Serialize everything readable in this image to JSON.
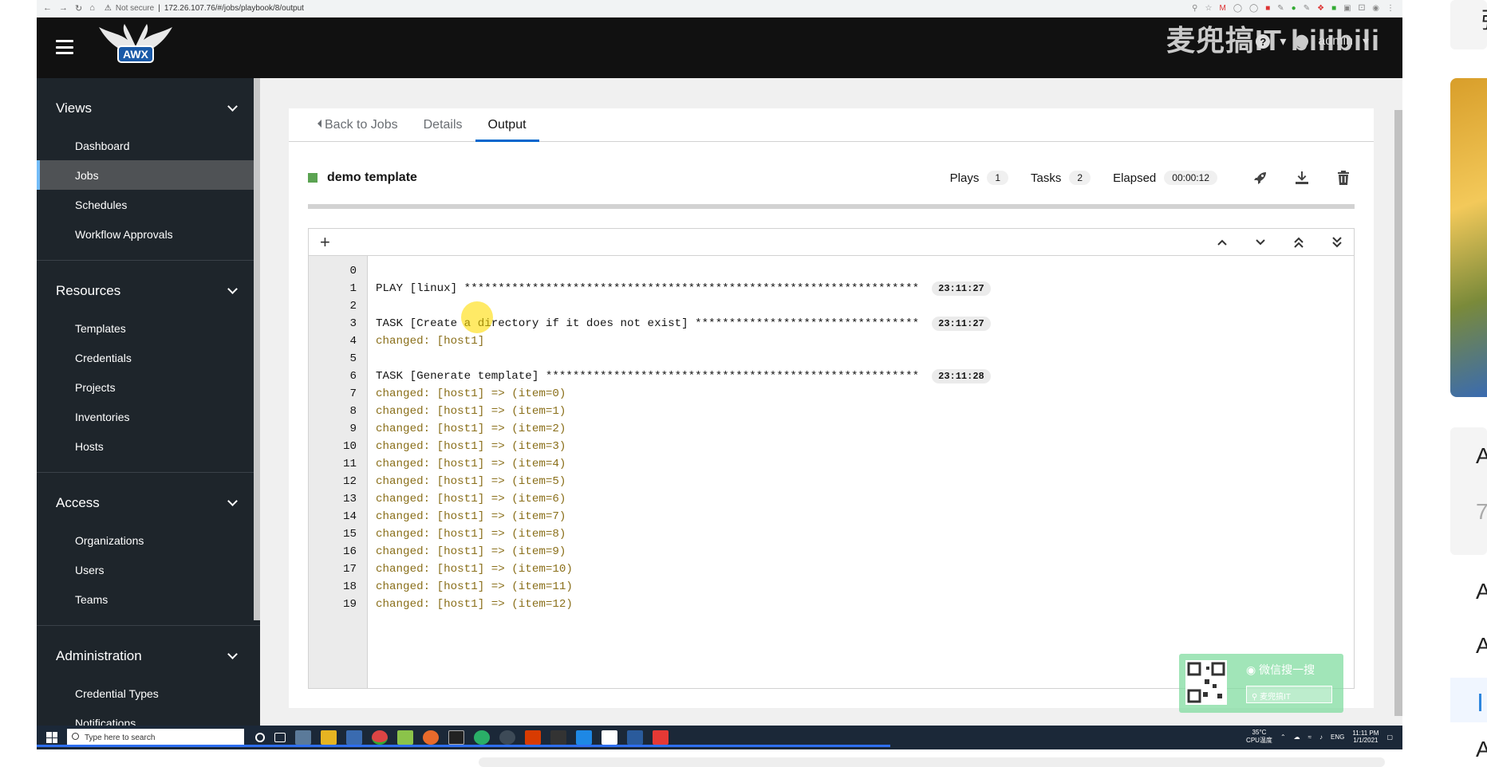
{
  "browser": {
    "not_secure": "Not secure",
    "url": "172.26.107.76/#/jobs/playbook/8/output"
  },
  "header": {
    "logo_text": "AWX",
    "user": "admin",
    "watermark": "麦兜搞IT bilibili"
  },
  "sidebar": {
    "sections": [
      {
        "label": "Views",
        "items": [
          "Dashboard",
          "Jobs",
          "Schedules",
          "Workflow Approvals"
        ]
      },
      {
        "label": "Resources",
        "items": [
          "Templates",
          "Credentials",
          "Projects",
          "Inventories",
          "Hosts"
        ]
      },
      {
        "label": "Access",
        "items": [
          "Organizations",
          "Users",
          "Teams"
        ]
      },
      {
        "label": "Administration",
        "items": [
          "Credential Types",
          "Notifications"
        ]
      }
    ]
  },
  "tabs": {
    "back": "Back to Jobs",
    "details": "Details",
    "output": "Output"
  },
  "job": {
    "title": "demo template",
    "plays_label": "Plays",
    "plays_value": "1",
    "tasks_label": "Tasks",
    "tasks_value": "2",
    "elapsed_label": "Elapsed",
    "elapsed_value": "00:00:12"
  },
  "output_lines": [
    {
      "n": "0",
      "text": "",
      "type": "plain",
      "ts": ""
    },
    {
      "n": "1",
      "text": "PLAY [linux] *******************************************************************",
      "type": "plain",
      "ts": "23:11:27"
    },
    {
      "n": "2",
      "text": "",
      "type": "plain",
      "ts": ""
    },
    {
      "n": "3",
      "text": "TASK [Create a directory if it does not exist] *********************************",
      "type": "plain",
      "ts": "23:11:27"
    },
    {
      "n": "4",
      "text": "changed: [host1]",
      "type": "changed",
      "ts": ""
    },
    {
      "n": "5",
      "text": "",
      "type": "plain",
      "ts": ""
    },
    {
      "n": "6",
      "text": "TASK [Generate template] *******************************************************",
      "type": "plain",
      "ts": "23:11:28"
    },
    {
      "n": "7",
      "text": "changed: [host1] => (item=0)",
      "type": "changed",
      "ts": ""
    },
    {
      "n": "8",
      "text": "changed: [host1] => (item=1)",
      "type": "changed",
      "ts": ""
    },
    {
      "n": "9",
      "text": "changed: [host1] => (item=2)",
      "type": "changed",
      "ts": ""
    },
    {
      "n": "10",
      "text": "changed: [host1] => (item=3)",
      "type": "changed",
      "ts": ""
    },
    {
      "n": "11",
      "text": "changed: [host1] => (item=4)",
      "type": "changed",
      "ts": ""
    },
    {
      "n": "12",
      "text": "changed: [host1] => (item=5)",
      "type": "changed",
      "ts": ""
    },
    {
      "n": "13",
      "text": "changed: [host1] => (item=6)",
      "type": "changed",
      "ts": ""
    },
    {
      "n": "14",
      "text": "changed: [host1] => (item=7)",
      "type": "changed",
      "ts": ""
    },
    {
      "n": "15",
      "text": "changed: [host1] => (item=8)",
      "type": "changed",
      "ts": ""
    },
    {
      "n": "16",
      "text": "changed: [host1] => (item=9)",
      "type": "changed",
      "ts": ""
    },
    {
      "n": "17",
      "text": "changed: [host1] => (item=10)",
      "type": "changed",
      "ts": ""
    },
    {
      "n": "18",
      "text": "changed: [host1] => (item=11)",
      "type": "changed",
      "ts": ""
    },
    {
      "n": "19",
      "text": "changed: [host1] => (item=12)",
      "type": "changed",
      "ts": ""
    }
  ],
  "overlay": {
    "wechat": "微信搜一搜",
    "search": "麦兜搞IT"
  },
  "taskbar": {
    "search_placeholder": "Type here to search",
    "temp": "35°C",
    "temp_label": "CPU温度",
    "lang": "ENG",
    "time": "11:11 PM",
    "date": "1/1/2021"
  },
  "right_strip": {
    "letters": [
      "张",
      "A",
      "7",
      "A",
      "A",
      "A"
    ]
  },
  "colors": {
    "status_success": "#5ba352",
    "active_tab": "#0066cc",
    "changed_text": "#8a6f1a",
    "sidebar_bg": "#1e252b"
  }
}
